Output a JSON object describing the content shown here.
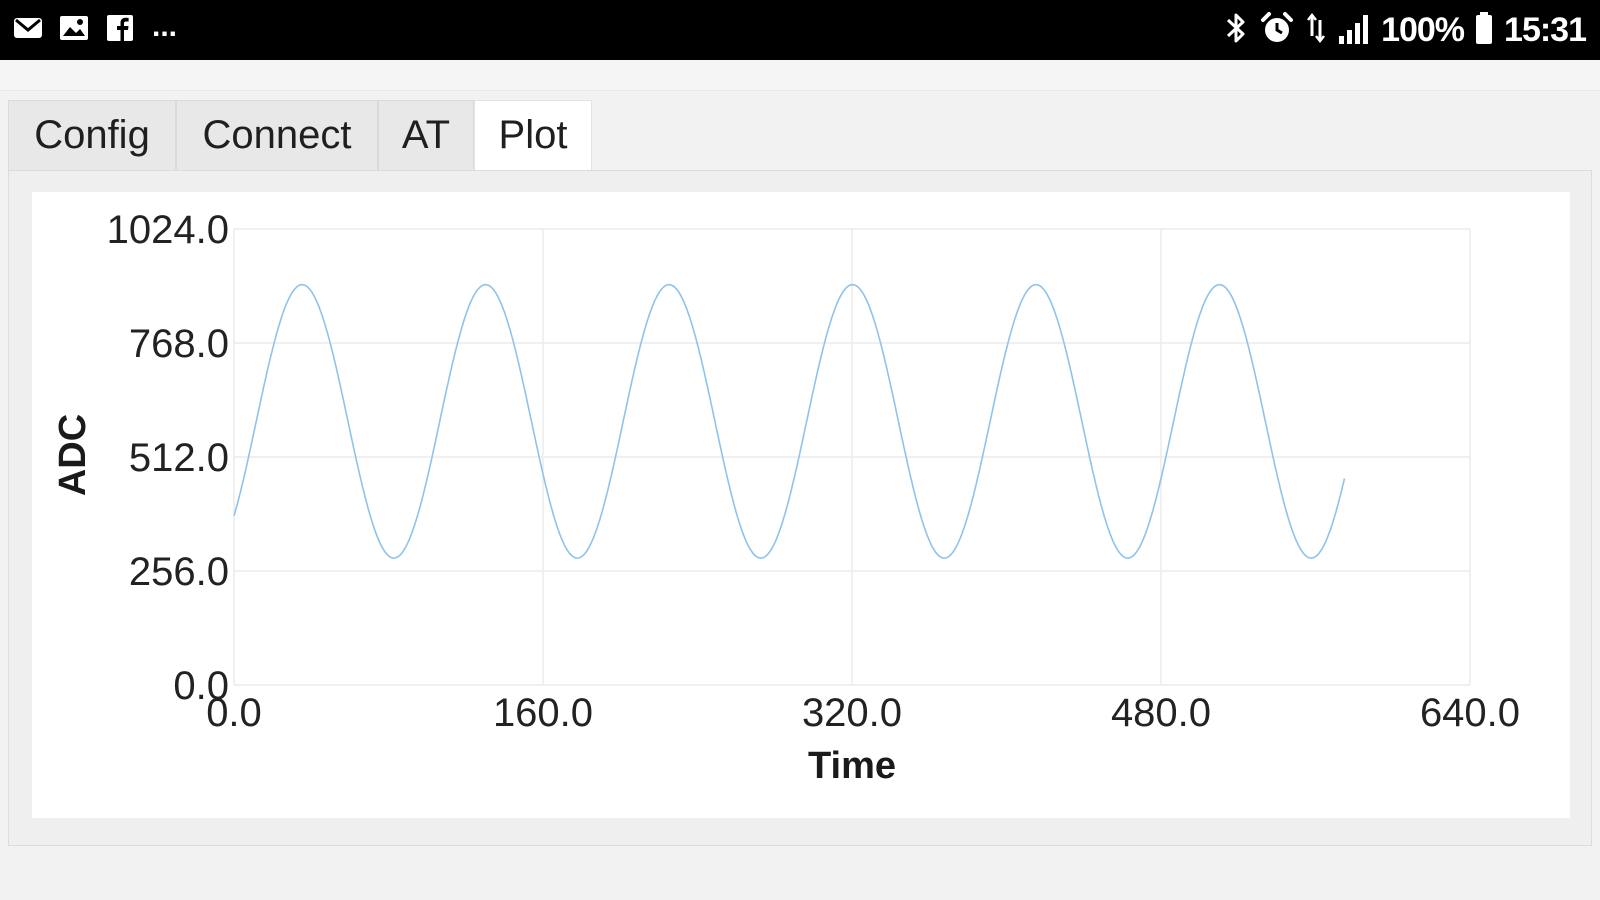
{
  "status_bar": {
    "left_icons": [
      "gmail-icon",
      "gallery-icon",
      "facebook-icon"
    ],
    "more_label": "...",
    "right_icons": [
      "bluetooth-icon",
      "alarm-icon",
      "data-transfer-icon",
      "signal-icon"
    ],
    "battery_label": "100%",
    "time": "15:31"
  },
  "tabs": [
    {
      "label": "Config",
      "active": false
    },
    {
      "label": "Connect",
      "active": false
    },
    {
      "label": "AT",
      "active": false
    },
    {
      "label": "Plot",
      "active": true
    }
  ],
  "colors": {
    "line": "#8fc3ea",
    "grid": "#ececec",
    "status_bar": "#000000"
  },
  "chart_data": {
    "type": "line",
    "xlabel": "Time",
    "ylabel": "ADC",
    "xlim": [
      0,
      640
    ],
    "ylim": [
      0,
      1024
    ],
    "x_ticks": [
      "0.0",
      "160.0",
      "320.0",
      "480.0",
      "640.0"
    ],
    "y_ticks": [
      "0.0",
      "256.0",
      "512.0",
      "768.0",
      "1024.0"
    ],
    "grid": true,
    "series": [
      {
        "x_start": 0,
        "x_end": 575,
        "form": "sine",
        "offset": 592,
        "amplitude": 307,
        "period": 95,
        "start_value": 380,
        "end_value": 535,
        "peaks_y": [
          899,
          899,
          899,
          899,
          899,
          899
        ],
        "troughs_y": [
          285,
          285,
          285,
          285,
          285,
          285
        ]
      }
    ]
  }
}
